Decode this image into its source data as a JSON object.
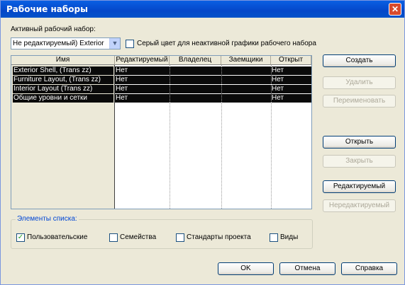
{
  "window": {
    "title": "Рабочие наборы"
  },
  "active_label": "Активный рабочий набор:",
  "active_value": "Не редактируемый) Exterior S",
  "gray_label": "Серый цвет для неактивной графики рабочего набора",
  "gray_checked": false,
  "columns": [
    "Имя",
    "Редактируемый",
    "Владелец",
    "Заемщики",
    "Открыт"
  ],
  "rows": [
    {
      "name": "Exterior Shell, (Trans zz)",
      "editable": "Нет",
      "owner": "",
      "borrowers": "",
      "open": "Нет"
    },
    {
      "name": "Furniture Layout, (Trans zz)",
      "editable": "Нет",
      "owner": "",
      "borrowers": "",
      "open": "Нет"
    },
    {
      "name": "Interior Layout (Trans zz)",
      "editable": "Нет",
      "owner": "",
      "borrowers": "",
      "open": "Нет"
    },
    {
      "name": "Общие уровни и сетки",
      "editable": "Нет",
      "owner": "",
      "borrowers": "",
      "open": "Нет"
    }
  ],
  "side_buttons": {
    "create": "Создать",
    "delete": "Удалить",
    "rename": "Переименовать",
    "open": "Открыть",
    "close": "Закрыть",
    "editable": "Редактируемый",
    "noneditable": "Нередактируемый"
  },
  "list_group": {
    "title": "Элементы списка:",
    "user": "Пользовательские",
    "user_checked": true,
    "families": "Семейства",
    "families_checked": false,
    "standards": "Стандарты проекта",
    "standards_checked": false,
    "views": "Виды",
    "views_checked": false
  },
  "footer": {
    "ok": "OK",
    "cancel": "Отмена",
    "help": "Справка"
  }
}
